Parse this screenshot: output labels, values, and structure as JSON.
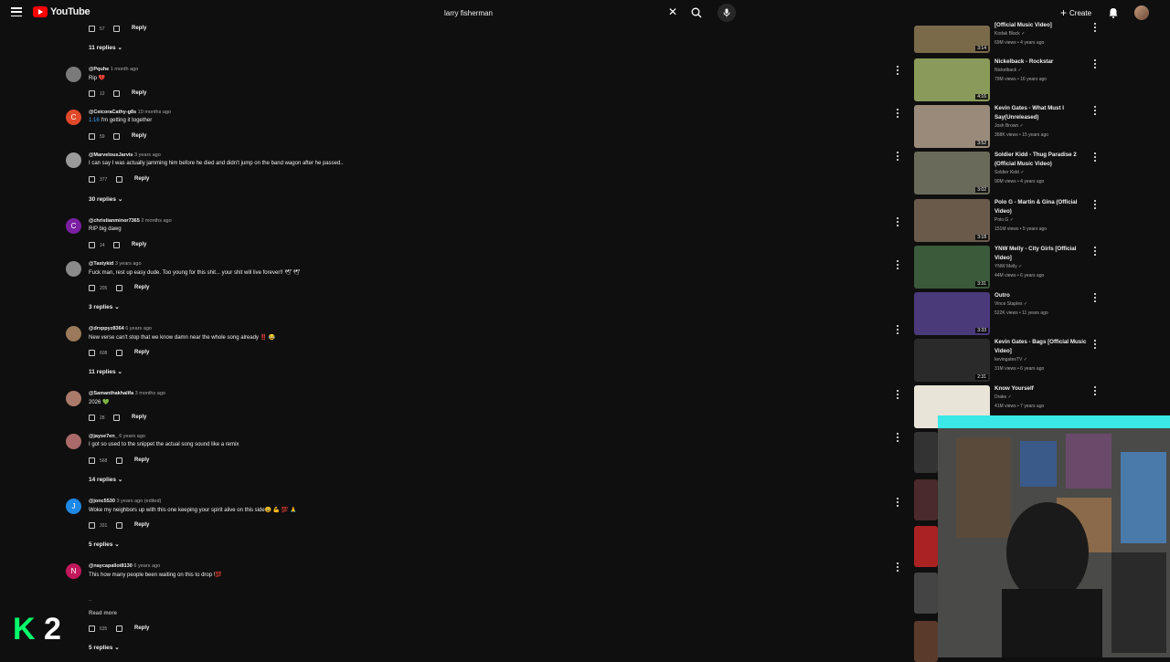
{
  "topbar": {
    "logo_text": "YouTube",
    "search_value": "larry fisherman",
    "create_label": "Create"
  },
  "comments": [
    {
      "user": "",
      "time": "",
      "text": "",
      "likes": "57",
      "replies": "11 replies",
      "initial": ""
    },
    {
      "user": "@Pquhe",
      "time": "1 month ago",
      "text": "Rip 💔",
      "likes": "12",
      "replies": "",
      "initial": ""
    },
    {
      "user": "@CeicoraCathy-g8s",
      "time": "10 months ago",
      "timestamp_link": "1:16",
      "text": "I'm getting it together",
      "likes": "59",
      "replies": "",
      "initial": "C"
    },
    {
      "user": "@MarvelousJarvis",
      "time": "3 years ago",
      "text": "I can say I was actually jamming him before he died and didn't jump on the band wagon after he passed..",
      "likes": "377",
      "replies": "30 replies",
      "initial": ""
    },
    {
      "user": "@christianminor7365",
      "time": "2 months ago",
      "text": "RIP big dawg",
      "likes": "14",
      "replies": "",
      "initial": "C"
    },
    {
      "user": "@Tastykid",
      "time": "3 years ago",
      "text": "Fuck man, rest up easy dude. Too young for this shit... your shit will live forever!! 🕊 🕊",
      "likes": "205",
      "replies": "3 replies",
      "initial": ""
    },
    {
      "user": "@drxppyz8364",
      "time": "6 years ago",
      "text": "New verse can't stop that we know damn near the whole song already ‼️ 😂",
      "likes": "608",
      "replies": "11 replies",
      "initial": ""
    },
    {
      "user": "@Samanthakhalifa",
      "time": "3 months ago",
      "text": "2026 💚",
      "likes": "28",
      "replies": "",
      "initial": ""
    },
    {
      "user": "@jayse7en_",
      "time": "6 years ago",
      "text": "I got so used to the snippet the actual song sound like a remix",
      "likes": "568",
      "replies": "14 replies",
      "initial": ""
    },
    {
      "user": "@jonc5530",
      "time": "3 years ago (edited)",
      "text": "Woke my neighbors up with this one keeping your spirit alive on this side😩 💪 💯 🙏",
      "likes": "331",
      "replies": "5 replies",
      "initial": "J"
    },
    {
      "user": "@naycapallot8130",
      "time": "6 years ago",
      "text": "This how many people been waiting on this to drop !💯",
      "likes": "635",
      "replies": "5 replies",
      "initial": "N",
      "extra_line": "..",
      "read_more": "Read more"
    }
  ],
  "reply_label": "Reply",
  "sidebar_videos": [
    {
      "title": "[Official Music Video]",
      "channel": "Kodak Black",
      "meta": "69M views • 4 years ago",
      "duration": "3:14"
    },
    {
      "title": "Nickelback - Rockstar",
      "channel": "Nickelback",
      "meta": "79M views • 16 years ago",
      "duration": "4:16"
    },
    {
      "title": "Kevin Gates - What Must I Say(Unreleased)",
      "channel": "Josh Brown",
      "meta": "368K views • 15 years ago",
      "duration": "3:52"
    },
    {
      "title": "Soldier Kidd - Thug Paradise 2 (Official Music Video)",
      "channel": "Soldier Kidd",
      "meta": "90M views • 4 years ago",
      "duration": "3:02"
    },
    {
      "title": "Polo G - Martin & Gina (Official Video)",
      "channel": "Polo G",
      "meta": "151M views • 5 years ago",
      "duration": "3:18"
    },
    {
      "title": "YNW Melly - City Girls [Official Video]",
      "channel": "YNW Melly",
      "meta": "44M views • 6 years ago",
      "duration": "3:31"
    },
    {
      "title": "Outro",
      "channel": "Vince Staples",
      "meta": "522K views • 11 years ago",
      "duration": "3:33"
    },
    {
      "title": "Kevin Gates - Bags [Official Music Video]",
      "channel": "kevingatesTV",
      "meta": "31M views • 6 years ago",
      "duration": "2:31"
    },
    {
      "title": "Know Yourself",
      "channel": "Drake",
      "meta": "41M views • 7 years ago",
      "duration": ""
    }
  ],
  "thumb_colors": [
    "#7a6a4a",
    "#8a9a5a",
    "#9a8a7a",
    "#6a6a5a",
    "#6a5a4a",
    "#3a5a3a",
    "#4a3a7a",
    "#2a2a2a",
    "#e8e4d8"
  ],
  "overlay": {
    "logo": "K 2",
    "accent": "#00ff6a"
  }
}
